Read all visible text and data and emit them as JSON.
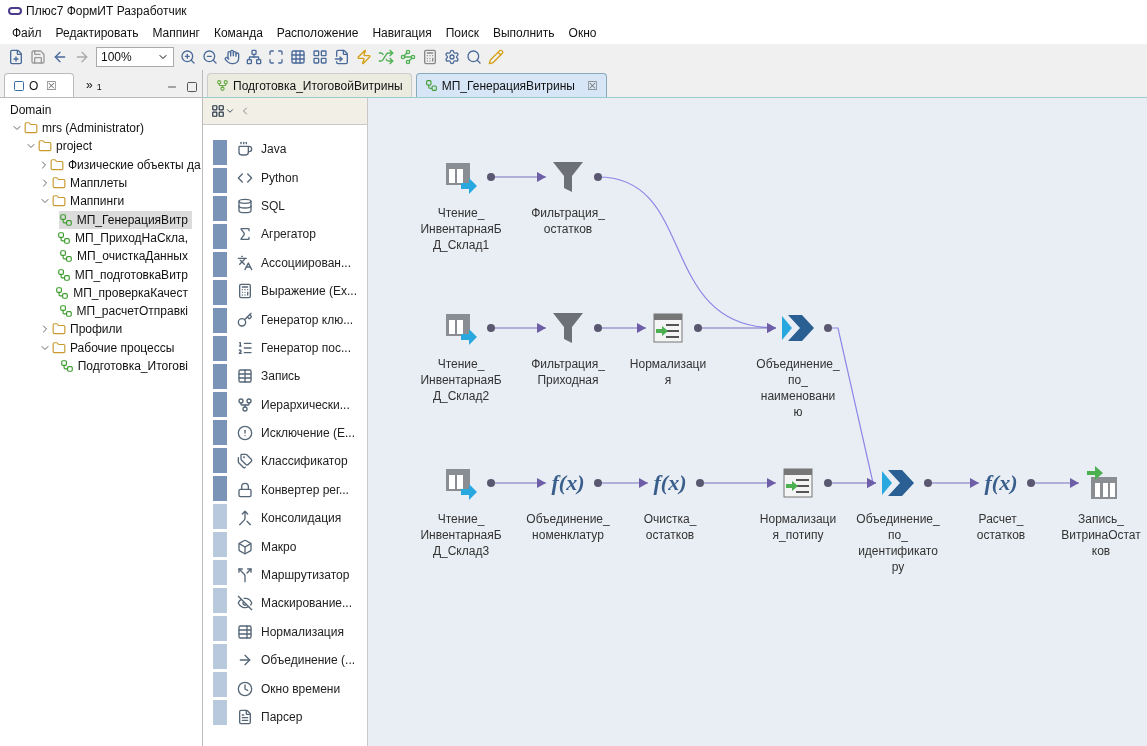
{
  "window": {
    "title": "Плюс7 ФормИТ Разработчик"
  },
  "menu": [
    "Файл",
    "Редактировать",
    "Маппинг",
    "Команда",
    "Расположение",
    "Навигация",
    "Поиск",
    "Выполнить",
    "Окно"
  ],
  "toolbar": {
    "zoom": "100%"
  },
  "left_panel": {
    "tabs": [
      {
        "label": "O",
        "selected": true,
        "close": "☒"
      },
      {
        "label": "»",
        "sub": "1",
        "selected": false
      }
    ],
    "root": "Domain",
    "tree": [
      {
        "label": "mrs (Administrator)",
        "expanded": true,
        "selected": false,
        "children": [
          {
            "label": "project",
            "expanded": true,
            "selected": false,
            "children": [
              {
                "label": "Физические объекты да",
                "expanded": false,
                "selected": false
              },
              {
                "label": "Мапплеты",
                "expanded": false,
                "selected": false
              },
              {
                "label": "Маппинги",
                "expanded": true,
                "selected": false,
                "children": [
                  {
                    "label": "МП_ГенерацияВитр",
                    "selected": true
                  },
                  {
                    "label": "МП_ПриходНаСкла,",
                    "selected": false
                  },
                  {
                    "label": "МП_очисткаДанных",
                    "selected": false
                  },
                  {
                    "label": "МП_подготовкаВитр",
                    "selected": false
                  },
                  {
                    "label": "МП_проверкаКачест",
                    "selected": false
                  },
                  {
                    "label": "МП_расчетОтправкі",
                    "selected": false
                  }
                ]
              },
              {
                "label": "Профили",
                "expanded": false,
                "selected": false
              },
              {
                "label": "Рабочие процессы",
                "expanded": true,
                "selected": false,
                "children": [
                  {
                    "label": "Подготовка_Итогові",
                    "selected": false
                  }
                ]
              }
            ]
          }
        ]
      }
    ]
  },
  "editor_tabs": [
    {
      "label": "Подготовка_ИтоговойВитрины",
      "selected": false
    },
    {
      "label": "МП_ГенерацияВитрины",
      "selected": true,
      "close": "☒"
    }
  ],
  "palette": [
    "Java",
    "Python",
    "SQL",
    "Агрегатор",
    "Ассоциирован...",
    "Выражение (Ex...",
    "Генератор клю...",
    "Генератор пос...",
    "Запись",
    "Иерархически...",
    "Исключение (E...",
    "Классификатор",
    "Конвертер рег...",
    "Консолидация",
    "Макро",
    "Маршрутизатор",
    "Маскирование...",
    "Нормализация",
    "Объединение (...",
    "Окно времени",
    "Парсер"
  ],
  "diagram": {
    "nodes": [
      {
        "kind": "source",
        "label": [
          "Чтение_",
          "ИнвентарнаяБ",
          "Д_Склад1"
        ]
      },
      {
        "kind": "filter",
        "label": [
          "Фильтрация_",
          "остатков"
        ]
      },
      {
        "kind": "source",
        "label": [
          "Чтение_",
          "ИнвентарнаяБ",
          "Д_Склад2"
        ]
      },
      {
        "kind": "filter",
        "label": [
          "Фильтрация_",
          "Приходная"
        ]
      },
      {
        "kind": "normalizer",
        "label": [
          "Нормализаци",
          "я"
        ]
      },
      {
        "kind": "union",
        "label": [
          "Объединение_",
          "по_",
          "наименовани",
          "ю"
        ]
      },
      {
        "kind": "source",
        "label": [
          "Чтение_",
          "ИнвентарнаяБ",
          "Д_Склад3"
        ]
      },
      {
        "kind": "expression",
        "symbol": "f(x)",
        "label": [
          "Объединение_",
          "номенклатур"
        ]
      },
      {
        "kind": "expression",
        "symbol": "f(x)",
        "label": [
          "Очистка_",
          "остатков"
        ]
      },
      {
        "kind": "normalizer",
        "label": [
          "Нормализаци",
          "я_потипу"
        ]
      },
      {
        "kind": "union",
        "label": [
          "Объединение_",
          "по_",
          "идентификато",
          "ру"
        ]
      },
      {
        "kind": "expression",
        "symbol": "f(x)",
        "label": [
          "Расчет_",
          "остатков"
        ]
      },
      {
        "kind": "target",
        "label": [
          "Запись_",
          "ВитринаОстат",
          "ков"
        ]
      }
    ]
  }
}
